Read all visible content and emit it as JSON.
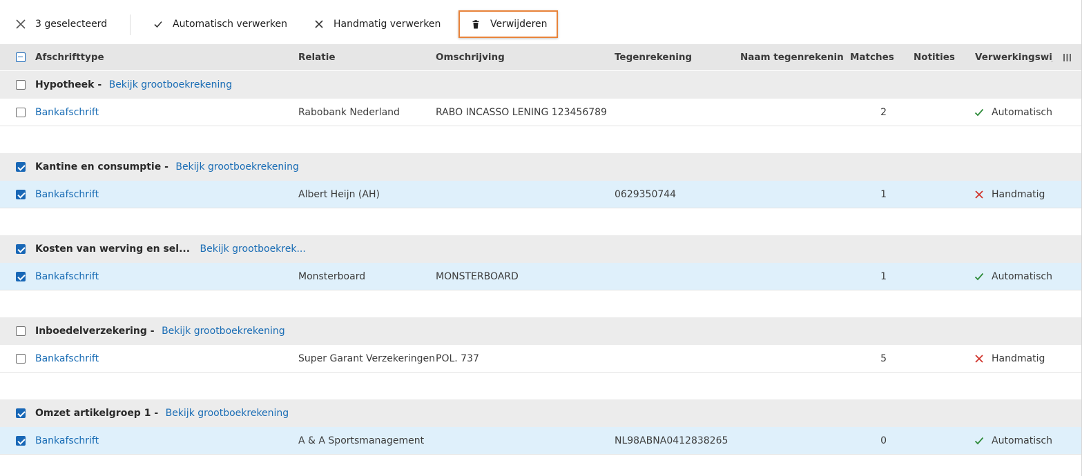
{
  "toolbar": {
    "selected_label": "3 geselecteerd",
    "auto_label": "Automatisch verwerken",
    "manual_label": "Handmatig verwerken",
    "delete_label": "Verwijderen"
  },
  "columns": {
    "type": "Afschrifttype",
    "relation": "Relatie",
    "description": "Omschrijving",
    "counter_account": "Tegenrekening",
    "counter_name": "Naam tegenrekening",
    "matches": "Matches",
    "notes": "Notities",
    "processing": "Verwerkingswijze"
  },
  "groups": [
    {
      "title": "Hypotheek -",
      "link": "Bekijk grootboekrekening",
      "checked": false,
      "item": {
        "type": "Bankafschrift",
        "relation": "Rabobank Nederland",
        "description": "RABO INCASSO LENING 123456789",
        "counter_account": "",
        "matches": "2",
        "status": "Automatisch",
        "status_icon": "check-icon",
        "checked": false
      }
    },
    {
      "title": "Kantine en consumptie -",
      "link": "Bekijk grootboekrekening",
      "checked": true,
      "item": {
        "type": "Bankafschrift",
        "relation": "Albert Heijn (AH)",
        "description": "",
        "counter_account": "0629350744",
        "matches": "1",
        "status": "Handmatig",
        "status_icon": "cross-icon",
        "checked": true
      }
    },
    {
      "title": "Kosten van werving en sel...",
      "link": "Bekijk grootboekrek...",
      "checked": true,
      "item": {
        "type": "Bankafschrift",
        "relation": "Monsterboard",
        "description": "MONSTERBOARD",
        "counter_account": "",
        "matches": "1",
        "status": "Automatisch",
        "status_icon": "check-icon",
        "checked": true
      }
    },
    {
      "title": "Inboedelverzekering -",
      "link": "Bekijk grootboekrekening",
      "checked": false,
      "item": {
        "type": "Bankafschrift",
        "relation": "Super Garant Verzekeringen",
        "description": "POL. 737",
        "counter_account": "",
        "matches": "5",
        "status": "Handmatig",
        "status_icon": "cross-icon",
        "checked": false
      }
    },
    {
      "title": "Omzet artikelgroep 1 -",
      "link": "Bekijk grootboekrekening",
      "checked": true,
      "item": {
        "type": "Bankafschrift",
        "relation": "A & A Sportsmanagement",
        "description": "",
        "counter_account": "NL98ABNA0412838265",
        "matches": "0",
        "status": "Automatisch",
        "status_icon": "check-icon",
        "checked": true
      }
    }
  ],
  "colors": {
    "accent": "#1a6db5",
    "highlight": "#e8833a",
    "check": "#2e8b3a",
    "cross": "#d0342c",
    "selected_row": "#dff0fb"
  }
}
